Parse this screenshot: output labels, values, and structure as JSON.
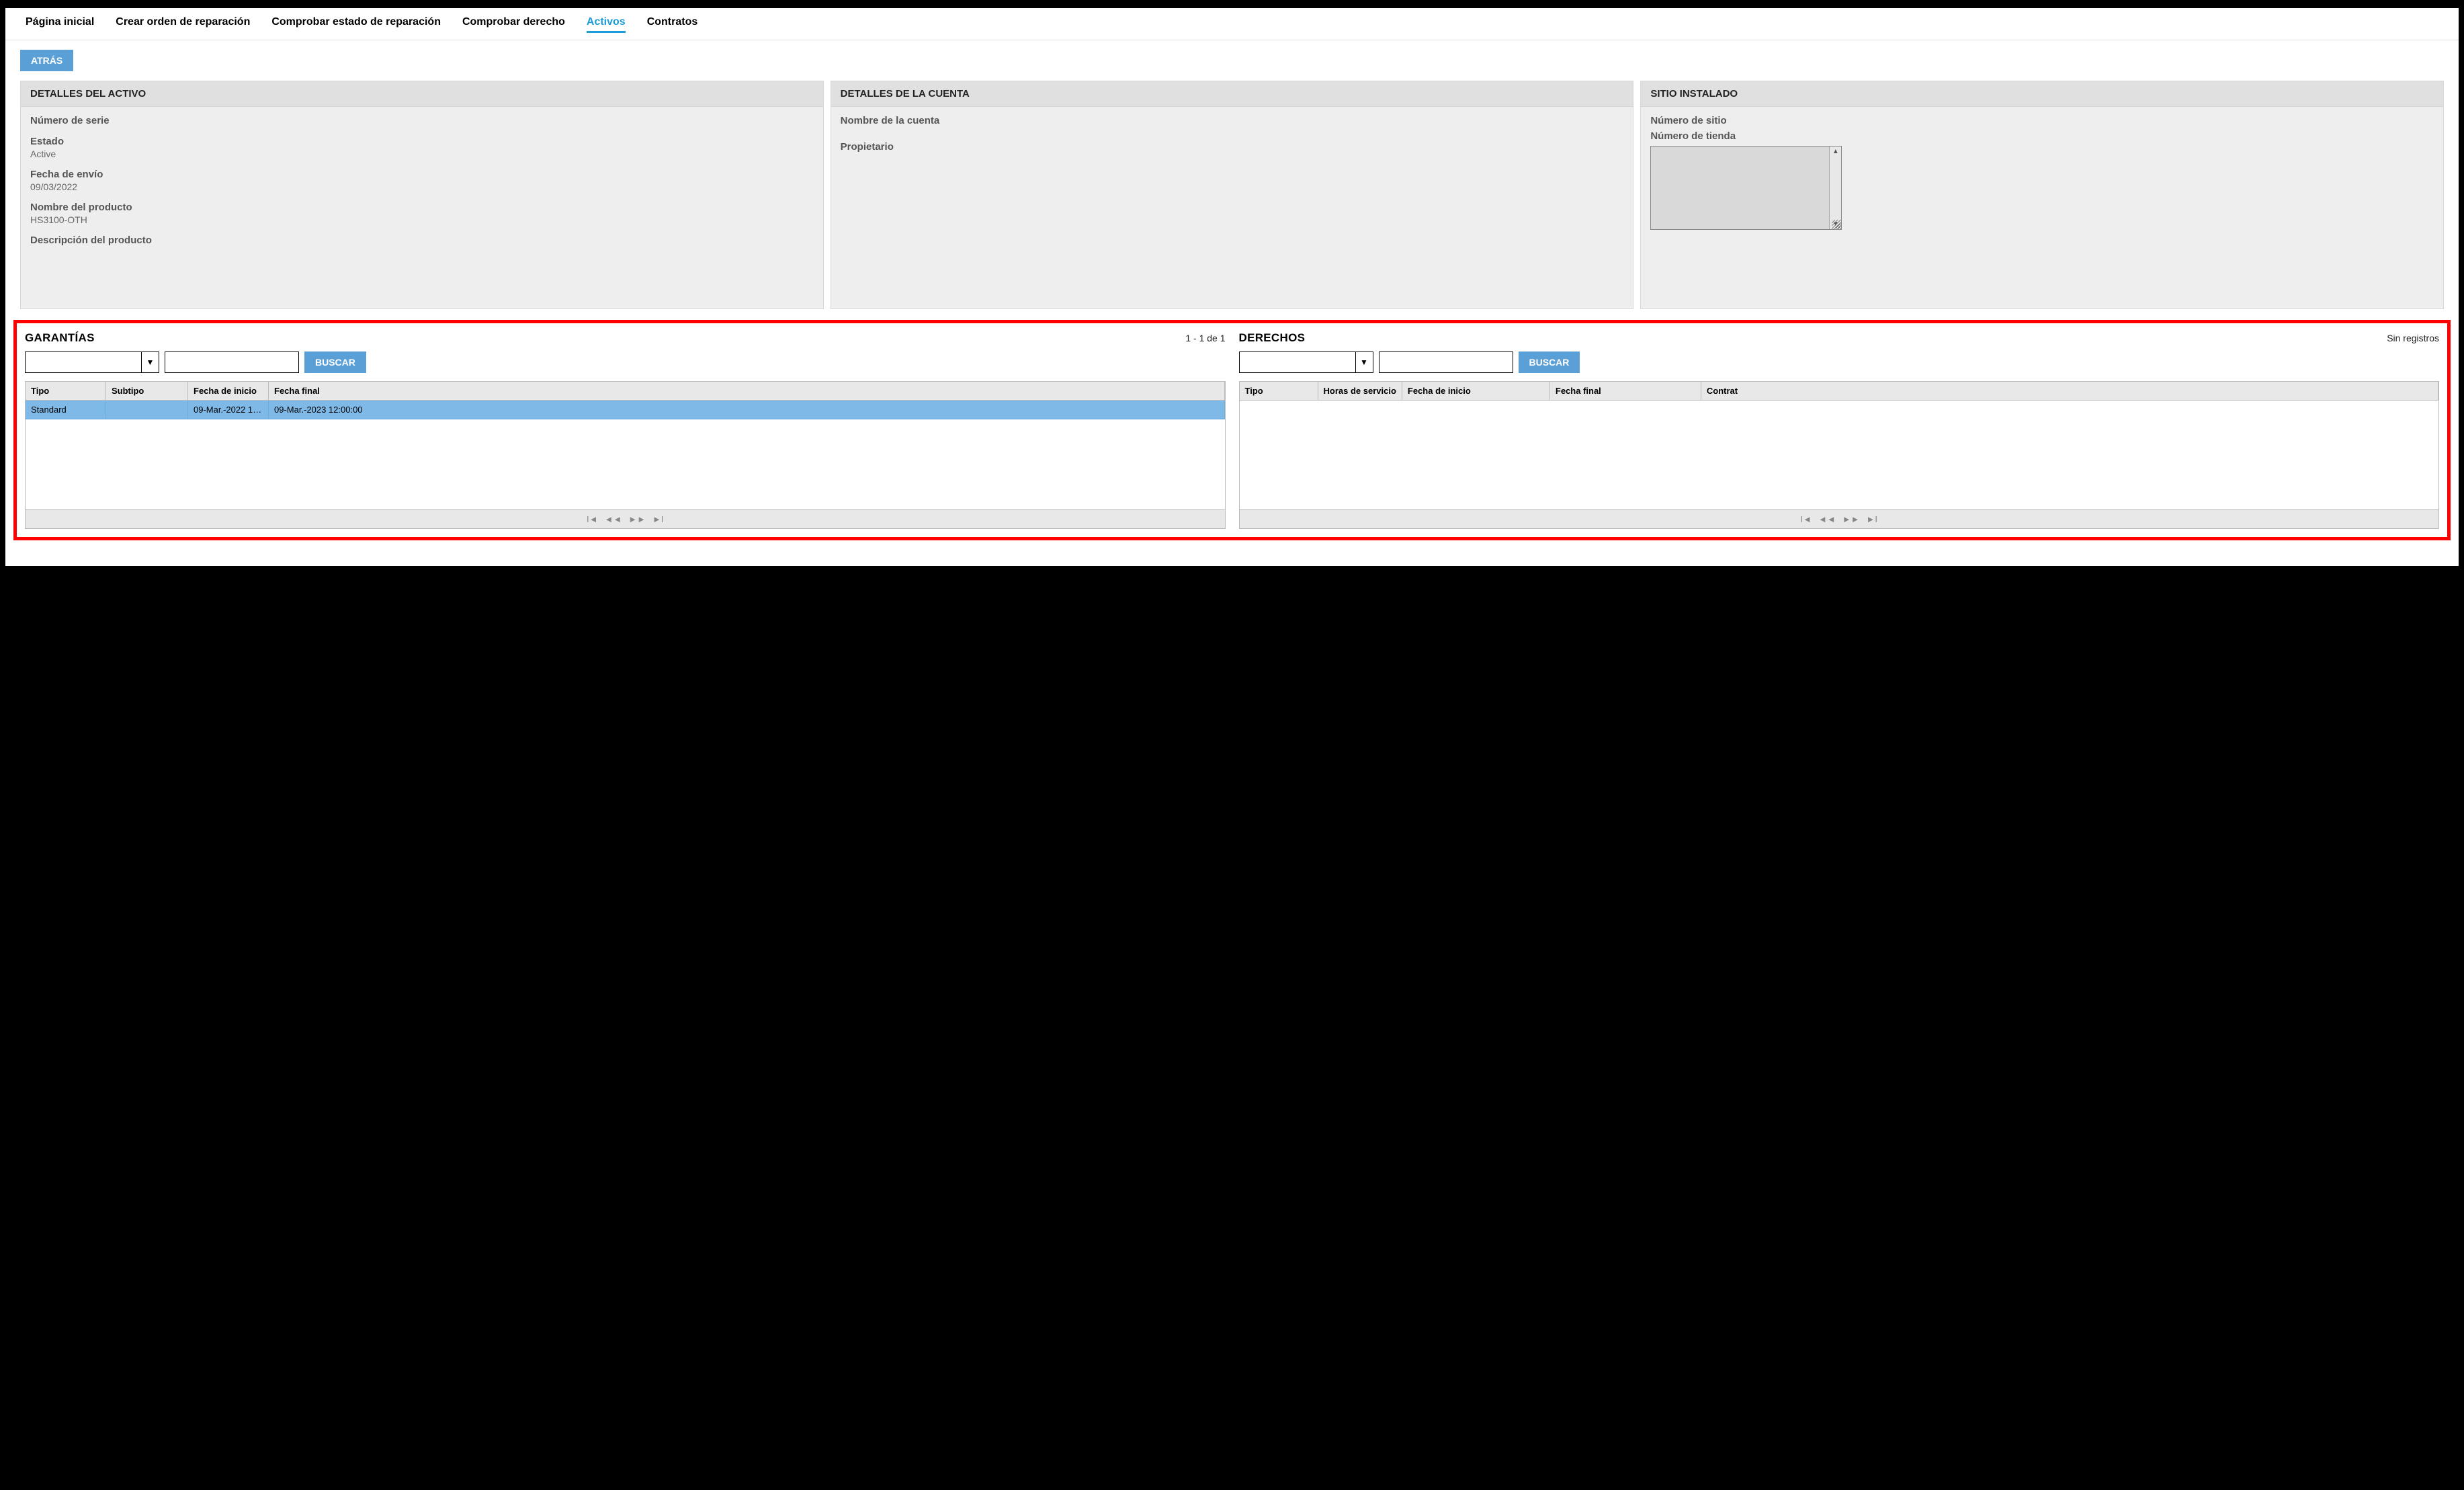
{
  "nav": {
    "tabs": [
      {
        "label": "Página inicial",
        "active": false
      },
      {
        "label": "Crear orden de reparación",
        "active": false
      },
      {
        "label": "Comprobar estado de reparación",
        "active": false
      },
      {
        "label": "Comprobar derecho",
        "active": false
      },
      {
        "label": "Activos",
        "active": true
      },
      {
        "label": "Contratos",
        "active": false
      }
    ]
  },
  "back_button": "ATRÁS",
  "panels": {
    "asset": {
      "title": "DETALLES DEL ACTIVO",
      "serial_label": "Número de serie",
      "serial_value": "",
      "status_label": "Estado",
      "status_value": "Active",
      "shipdate_label": "Fecha de envío",
      "shipdate_value": "09/03/2022",
      "product_label": "Nombre del producto",
      "product_value": "HS3100-OTH",
      "desc_label": "Descripción del producto",
      "desc_value": ""
    },
    "account": {
      "title": "DETALLES DE LA CUENTA",
      "name_label": "Nombre de la cuenta",
      "owner_label": "Propietario"
    },
    "site": {
      "title": "SITIO INSTALADO",
      "sitenum_label": "Número de sitio",
      "storenum_label": "Número de tienda"
    }
  },
  "warranties": {
    "title": "GARANTÍAS",
    "count": "1 - 1 de 1",
    "search_button": "BUSCAR",
    "cols": {
      "tipo": "Tipo",
      "subtipo": "Subtipo",
      "fini": "Fecha de inicio",
      "ffin": "Fecha final"
    },
    "rows": [
      {
        "tipo": "Standard",
        "subtipo": "",
        "fini": "09-Mar.-2022 12:...",
        "ffin": "09-Mar.-2023 12:00:00"
      }
    ]
  },
  "entitlements": {
    "title": "DERECHOS",
    "count": "Sin registros",
    "search_button": "BUSCAR",
    "cols": {
      "tipo": "Tipo",
      "horas": "Horas de servicio",
      "fini": "Fecha de inicio",
      "ffin": "Fecha final",
      "contrato": "Contrat"
    }
  }
}
